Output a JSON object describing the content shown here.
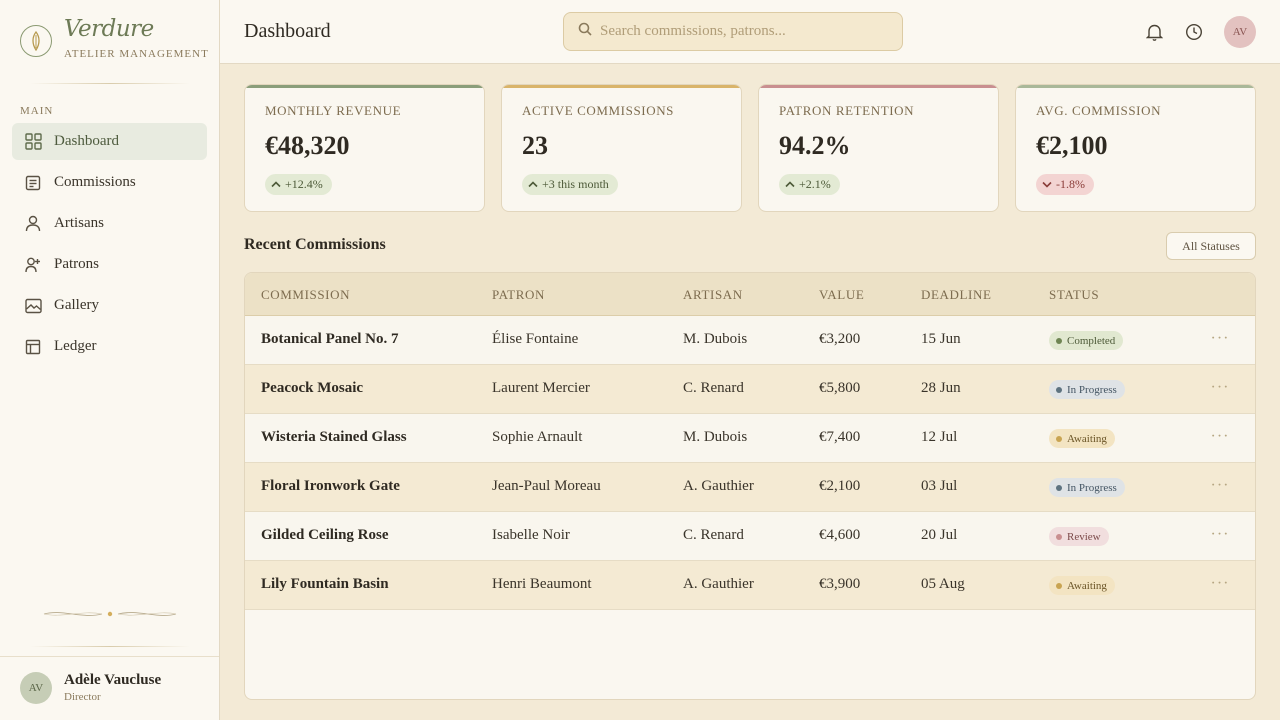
{
  "brand": {
    "name": "Verdure",
    "subtitle": "ATELIER MANAGEMENT"
  },
  "sidebar": {
    "section": "MAIN",
    "items": [
      {
        "label": "Dashboard",
        "icon": "grid-icon",
        "active": true
      },
      {
        "label": "Commissions",
        "icon": "document-icon"
      },
      {
        "label": "Artisans",
        "icon": "user-icon"
      },
      {
        "label": "Patrons",
        "icon": "users-icon"
      },
      {
        "label": "Gallery",
        "icon": "image-icon"
      },
      {
        "label": "Ledger",
        "icon": "ledger-icon"
      }
    ]
  },
  "user": {
    "initials": "AV",
    "name": "Adèle Vaucluse",
    "role": "Director"
  },
  "header": {
    "title": "Dashboard",
    "search_placeholder": "Search commissions, patrons...",
    "avatar_initials": "AV"
  },
  "stats": [
    {
      "label": "MONTHLY REVENUE",
      "value": "€48,320",
      "delta": "+12.4%",
      "trend": "up",
      "accent": "#8a9e7a"
    },
    {
      "label": "ACTIVE COMMISSIONS",
      "value": "23",
      "delta": "+3 this month",
      "trend": "up",
      "accent": "#d9b46a"
    },
    {
      "label": "PATRON RETENTION",
      "value": "94.2%",
      "delta": "+2.1%",
      "trend": "up",
      "accent": "#c98f90"
    },
    {
      "label": "AVG. COMMISSION",
      "value": "€2,100",
      "delta": "-1.8%",
      "trend": "down",
      "accent": "#a9b899"
    }
  ],
  "table": {
    "title": "Recent Commissions",
    "filter_label": "All Statuses",
    "columns": [
      "COMMISSION",
      "PATRON",
      "ARTISAN",
      "VALUE",
      "DEADLINE",
      "STATUS"
    ],
    "rows": [
      {
        "commission": "Botanical Panel No. 7",
        "patron": "Élise Fontaine",
        "artisan": "M. Dubois",
        "value": "€3,200",
        "deadline": "15 Jun",
        "status": "Completed",
        "status_kind": "completed"
      },
      {
        "commission": "Peacock Mosaic",
        "patron": "Laurent Mercier",
        "artisan": "C. Renard",
        "value": "€5,800",
        "deadline": "28 Jun",
        "status": "In Progress",
        "status_kind": "progress"
      },
      {
        "commission": "Wisteria Stained Glass",
        "patron": "Sophie Arnault",
        "artisan": "M. Dubois",
        "value": "€7,400",
        "deadline": "12 Jul",
        "status": "Awaiting",
        "status_kind": "awaiting"
      },
      {
        "commission": "Floral Ironwork Gate",
        "patron": "Jean-Paul Moreau",
        "artisan": "A. Gauthier",
        "value": "€2,100",
        "deadline": "03 Jul",
        "status": "In Progress",
        "status_kind": "progress"
      },
      {
        "commission": "Gilded Ceiling Rose",
        "patron": "Isabelle Noir",
        "artisan": "C. Renard",
        "value": "€4,600",
        "deadline": "20 Jul",
        "status": "Review",
        "status_kind": "review"
      },
      {
        "commission": "Lily Fountain Basin",
        "patron": "Henri Beaumont",
        "artisan": "A. Gauthier",
        "value": "€3,900",
        "deadline": "05 Aug",
        "status": "Awaiting",
        "status_kind": "awaiting"
      }
    ]
  }
}
